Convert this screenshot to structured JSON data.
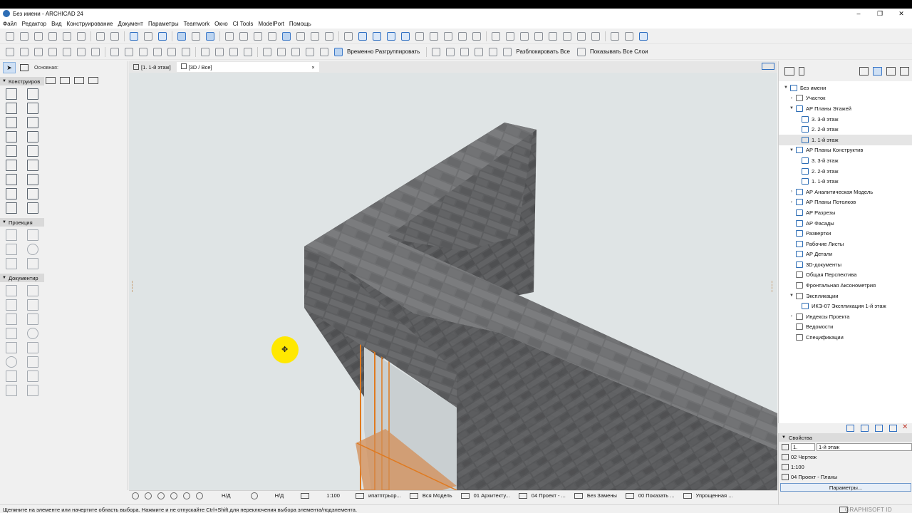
{
  "window": {
    "title": "Без имени - ARCHICAD 24",
    "minimize": "–",
    "maximize": "❐",
    "close": "✕"
  },
  "menu": [
    "Файл",
    "Редактор",
    "Вид",
    "Конструирование",
    "Документ",
    "Параметры",
    "Teamwork",
    "Окно",
    "CI Tools",
    "ModelPort",
    "Помощь"
  ],
  "toolbar2": {
    "regroup_label": "Временно Разгруппировать",
    "unlock_label": "Разблокировать Все",
    "show_layers_label": "Показывать Все Слои"
  },
  "toolbox": {
    "subtitle": "Основная:",
    "sections": {
      "design": "Конструиров",
      "projection": "Проекция",
      "documentation": "Документир"
    }
  },
  "tabs": {
    "plan": "[1. 1-й этаж]",
    "view3d": "[3D / Все]",
    "close": "×"
  },
  "viewbar": {
    "scale_nd1": "Н/Д",
    "scale_nd2": "Н/Д",
    "scale": "1:100",
    "layer_combo": "ипатптрьор...",
    "model": "Вся Модель",
    "pen_set": "01 Архитекту...",
    "display": "04 Проект - ...",
    "renovation": "Без Замены",
    "show": "00 Показать ...",
    "structure": "Упрощенная ..."
  },
  "status": {
    "hint": "Щелкните на элементе или начертите область выбора. Нажмите и не отпускайте Ctrl+Shift для переключения выбора элемента/подэлемента.",
    "brand": "GRAPHISOFT ID"
  },
  "navigator": {
    "items": [
      {
        "label": "Без имени",
        "indent": 0,
        "toggle": "▼",
        "icon": "project"
      },
      {
        "label": "Участок",
        "indent": 1,
        "toggle": "›",
        "icon": "folder"
      },
      {
        "label": "АР Планы Этажей",
        "indent": 1,
        "toggle": "▼",
        "icon": "plan"
      },
      {
        "label": "3. 3-й этаж",
        "indent": 2,
        "toggle": "",
        "icon": "plan"
      },
      {
        "label": "2. 2-й этаж",
        "indent": 2,
        "toggle": "",
        "icon": "plan"
      },
      {
        "label": "1. 1-й этаж",
        "indent": 2,
        "toggle": "",
        "icon": "plan",
        "selected": true
      },
      {
        "label": "АР Планы Конструктив",
        "indent": 1,
        "toggle": "▼",
        "icon": "plan"
      },
      {
        "label": "3. 3-й этаж",
        "indent": 2,
        "toggle": "",
        "icon": "plan"
      },
      {
        "label": "2. 2-й этаж",
        "indent": 2,
        "toggle": "",
        "icon": "plan"
      },
      {
        "label": "1. 1-й этаж",
        "indent": 2,
        "toggle": "",
        "icon": "plan"
      },
      {
        "label": "АР Аналитическая Модель",
        "indent": 1,
        "toggle": "›",
        "icon": "plan"
      },
      {
        "label": "АР Планы Потолков",
        "indent": 1,
        "toggle": "›",
        "icon": "plan"
      },
      {
        "label": "АР Разрезы",
        "indent": 1,
        "toggle": "",
        "icon": "section"
      },
      {
        "label": "АР Фасады",
        "indent": 1,
        "toggle": "",
        "icon": "section"
      },
      {
        "label": "Развертки",
        "indent": 1,
        "toggle": "",
        "icon": "section"
      },
      {
        "label": "Рабочие Листы",
        "indent": 1,
        "toggle": "",
        "icon": "sheet"
      },
      {
        "label": "АР Детали",
        "indent": 1,
        "toggle": "",
        "icon": "detail"
      },
      {
        "label": "3D-документы",
        "indent": 1,
        "toggle": "",
        "icon": "doc3d"
      },
      {
        "label": "Общая Перспектива",
        "indent": 1,
        "toggle": "",
        "icon": "folder"
      },
      {
        "label": "Фронтальная Аксонометрия",
        "indent": 1,
        "toggle": "",
        "icon": "folder"
      },
      {
        "label": "Экспликации",
        "indent": 1,
        "toggle": "▼",
        "icon": "folder"
      },
      {
        "label": "ИКЭ-07 Экспликация 1-й этаж",
        "indent": 2,
        "toggle": "",
        "icon": "table"
      },
      {
        "label": "Индексы Проекта",
        "indent": 1,
        "toggle": "›",
        "icon": "folder"
      },
      {
        "label": "Ведомости",
        "indent": 1,
        "toggle": "",
        "icon": "folder"
      },
      {
        "label": "Спецификации",
        "indent": 1,
        "toggle": "",
        "icon": "folder"
      }
    ]
  },
  "properties": {
    "header": "Свойства",
    "id_value": "1.",
    "name_value": "1-й этаж",
    "drawing": "02 Чертеж",
    "scale": "1:100",
    "display": "04 Проект - Планы",
    "button": "Параметры..."
  },
  "colors": {
    "accent": "#2f6fc2",
    "cursor_highlight": "#ffe800",
    "selection_orange": "#e07a1f"
  }
}
